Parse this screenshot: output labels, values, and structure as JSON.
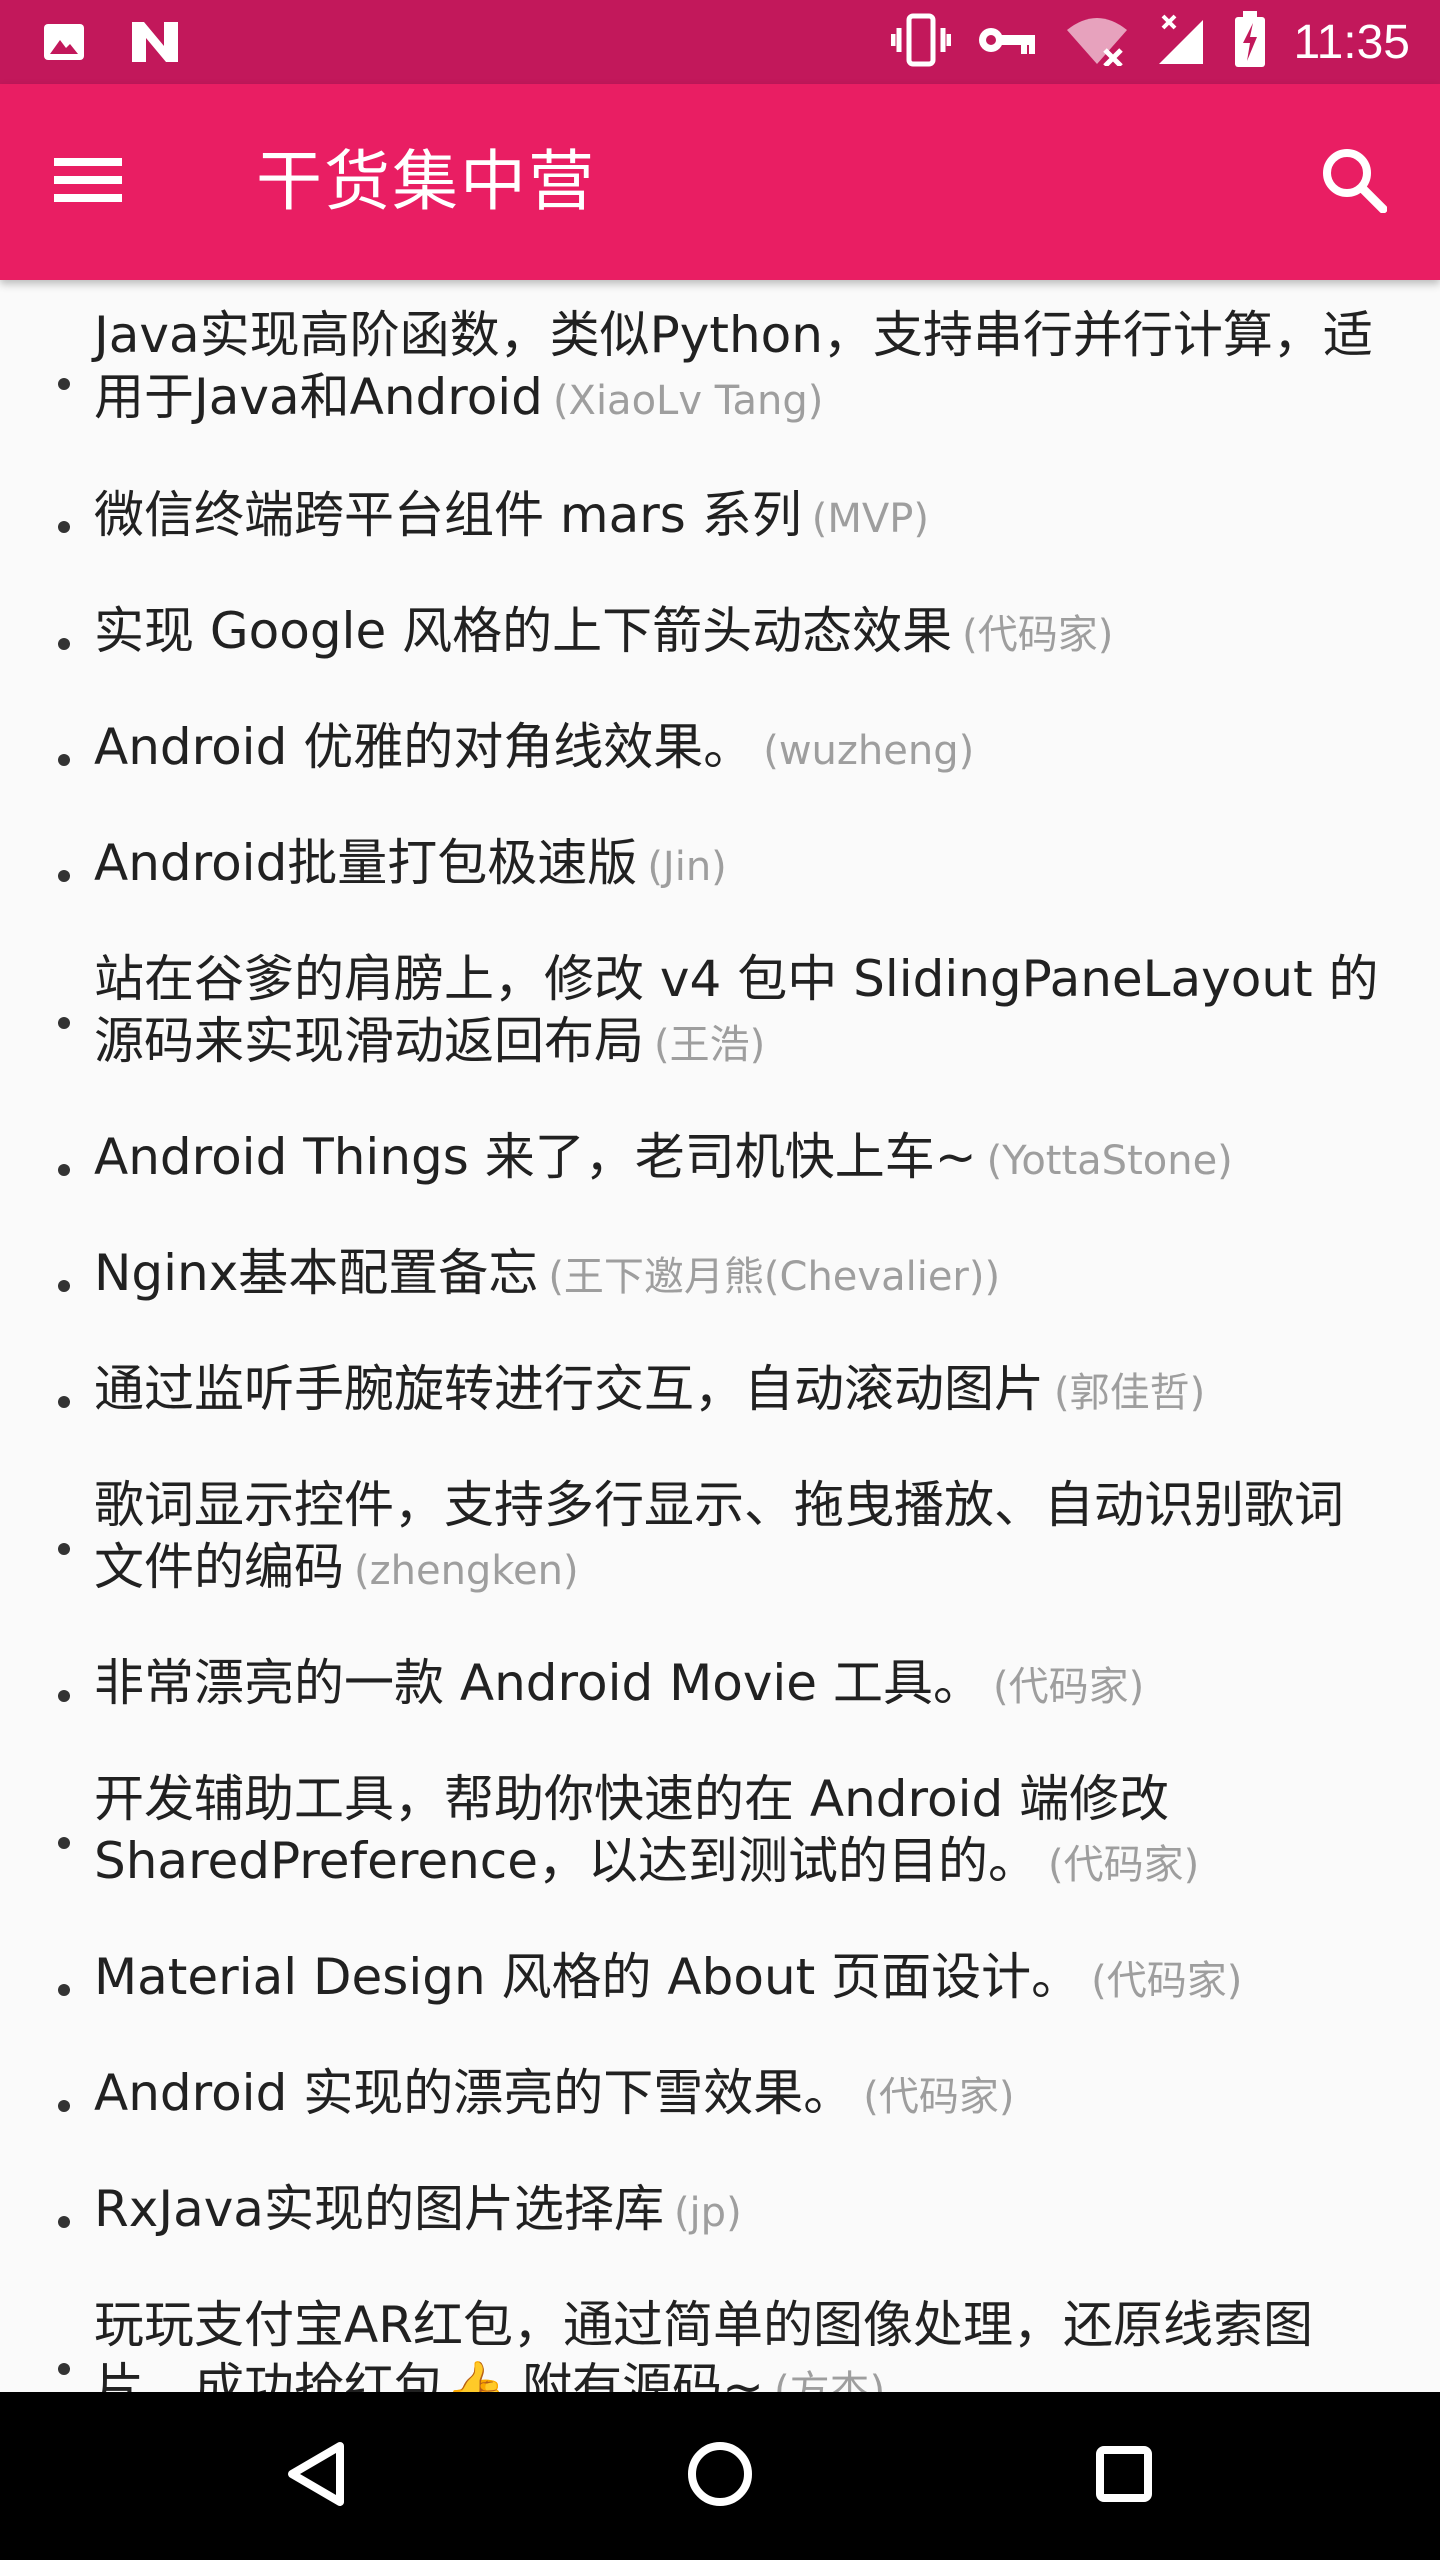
{
  "status_bar": {
    "time": "11:35",
    "left_icons": [
      "image-icon",
      "n-logo-icon"
    ],
    "right_icons": [
      "vibrate-icon",
      "vpn-key-icon",
      "wifi-off-icon",
      "signal-no-data-icon",
      "battery-charging-icon"
    ],
    "color": "#c2185b"
  },
  "app_bar": {
    "title": "干货集中营",
    "menu_icon": "menu-icon",
    "search_icon": "search-icon",
    "color": "#e91e63"
  },
  "list": {
    "items": [
      {
        "title": "Java实现高阶函数，类似Python，支持串行并行计算，适用于Java和Android",
        "author": "(XiaoLv Tang)"
      },
      {
        "title": "微信终端跨平台组件 mars 系列",
        "author": "(MVP)"
      },
      {
        "title": "实现 Google 风格的上下箭头动态效果",
        "author": "(代码家)"
      },
      {
        "title": "Android 优雅的对角线效果。",
        "author": "(wuzheng)"
      },
      {
        "title": "Android批量打包极速版",
        "author": "(Jin)"
      },
      {
        "title": "站在谷爹的肩膀上，修改 v4 包中 SlidingPaneLayout 的源码来实现滑动返回布局",
        "author": "(王浩)"
      },
      {
        "title": "Android Things 来了，老司机快上车~",
        "author": "(YottaStone)"
      },
      {
        "title": "Nginx基本配置备忘",
        "author": "(王下邀月熊(Chevalier))"
      },
      {
        "title": "通过监听手腕旋转进行交互，自动滚动图片",
        "author": "(郭佳哲)"
      },
      {
        "title": "歌词显示控件，支持多行显示、拖曳播放、自动识别歌词文件的编码",
        "author": "(zhengken)"
      },
      {
        "title": "非常漂亮的一款 Android Movie 工具。",
        "author": "(代码家)"
      },
      {
        "title": "开发辅助工具，帮助你快速的在 Android 端修改 SharedPreference，以达到测试的目的。",
        "author": "(代码家)"
      },
      {
        "title": "Material Design 风格的 About 页面设计。",
        "author": "(代码家)"
      },
      {
        "title": "Android 实现的漂亮的下雪效果。",
        "author": "(代码家)"
      },
      {
        "title": "RxJava实现的图片选择库",
        "author": "(jp)"
      },
      {
        "title": "玩玩支付宝AR红包，通过简单的图像处理，还原线索图片，成功抢红包👍 附有源码~",
        "author": "(方杰)"
      }
    ]
  },
  "nav_bar": {
    "back_icon": "back-icon",
    "home_icon": "home-icon",
    "recents_icon": "recents-icon"
  }
}
